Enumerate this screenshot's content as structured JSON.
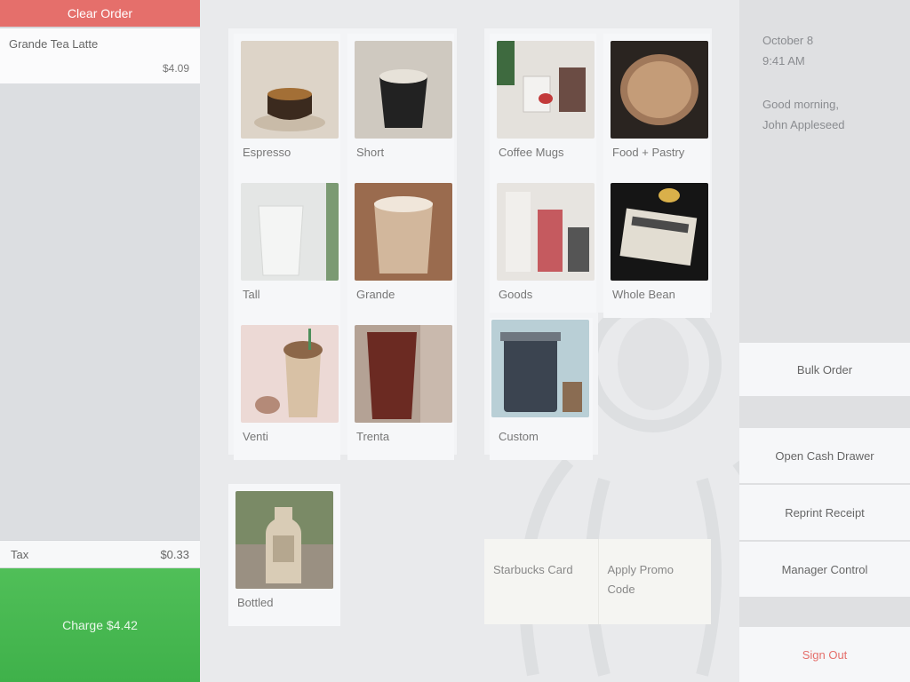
{
  "order": {
    "clear_label": "Clear Order",
    "items": [
      {
        "name": "Grande Tea Latte",
        "price": "$4.09"
      }
    ],
    "tax_label": "Tax",
    "tax_value": "$0.33",
    "charge_label": "Charge $4.42"
  },
  "drinks": [
    {
      "label": "Espresso"
    },
    {
      "label": "Short"
    },
    {
      "label": "Tall"
    },
    {
      "label": "Grande"
    },
    {
      "label": "Venti"
    },
    {
      "label": "Trenta"
    }
  ],
  "bottled": {
    "label": "Bottled"
  },
  "retail": [
    {
      "label": "Coffee Mugs"
    },
    {
      "label": "Food + Pastry"
    },
    {
      "label": "Goods"
    },
    {
      "label": "Whole Bean"
    },
    {
      "label": "Custom"
    }
  ],
  "promo": {
    "card_label": "Starbucks Card",
    "promo_label": "Apply Promo Code"
  },
  "status": {
    "date": "October 8",
    "time": "9:41 AM",
    "greeting_line1": "Good morning,",
    "greeting_line2": "John Appleseed"
  },
  "actions": {
    "bulk_order": "Bulk Order",
    "open_drawer": "Open Cash Drawer",
    "reprint": "Reprint Receipt",
    "manager": "Manager Control",
    "sign_out": "Sign Out"
  },
  "colors": {
    "clear": "#e56f6b",
    "charge": "#46b64f",
    "signout": "#e56f6b"
  }
}
